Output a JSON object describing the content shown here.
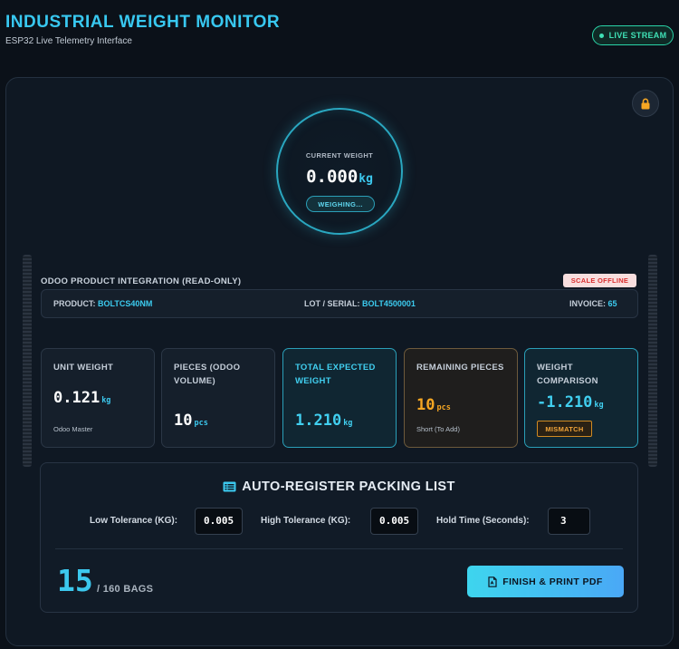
{
  "header": {
    "title": "INDUSTRIAL WEIGHT MONITOR",
    "subtitle": "ESP32 Live Telemetry Interface",
    "live_label": "LIVE STREAM"
  },
  "gauge": {
    "label": "CURRENT WEIGHT",
    "value": "0.000",
    "unit": "kg",
    "status": "WEIGHING..."
  },
  "odoo": {
    "title": "ODOO PRODUCT INTEGRATION (READ-ONLY)",
    "status_badge": "SCALE OFFLINE",
    "product_label": "PRODUCT:",
    "product_value": "BOLTCS40NM",
    "lot_label": "LOT / SERIAL:",
    "lot_value": "BOLT4500001",
    "invoice_label": "INVOICE:",
    "invoice_value": "65"
  },
  "cards": {
    "unit_weight": {
      "label": "UNIT WEIGHT",
      "value": "0.121",
      "unit": "kg",
      "note": "Odoo Master"
    },
    "pieces": {
      "label": "PIECES (ODOO VOLUME)",
      "value": "10",
      "unit": "pcs"
    },
    "total_expected": {
      "label": "TOTAL EXPECTED WEIGHT",
      "value": "1.210",
      "unit": "kg"
    },
    "remaining": {
      "label": "REMAINING PIECES",
      "value": "10",
      "unit": "pcs",
      "note": "Short (To Add)"
    },
    "comparison": {
      "label": "WEIGHT COMPARISON",
      "value": "-1.210",
      "unit": "kg",
      "badge": "MISMATCH"
    }
  },
  "packing": {
    "title": "AUTO-REGISTER PACKING LIST",
    "low_tol_label": "Low Tolerance (KG):",
    "low_tol_value": "0.005",
    "high_tol_label": "High Tolerance (KG):",
    "high_tol_value": "0.005",
    "hold_label": "Hold Time (Seconds):",
    "hold_value": "3",
    "count": "15",
    "total": "/ 160 BAGS",
    "finish_label": "FINISH & PRINT PDF"
  },
  "colors": {
    "accent": "#38c8f0",
    "live": "#3fe0b5",
    "warning": "#f5a623",
    "offline": "#d93030"
  },
  "icons": [
    "lock-icon",
    "list-icon",
    "pdf-file-icon"
  ]
}
